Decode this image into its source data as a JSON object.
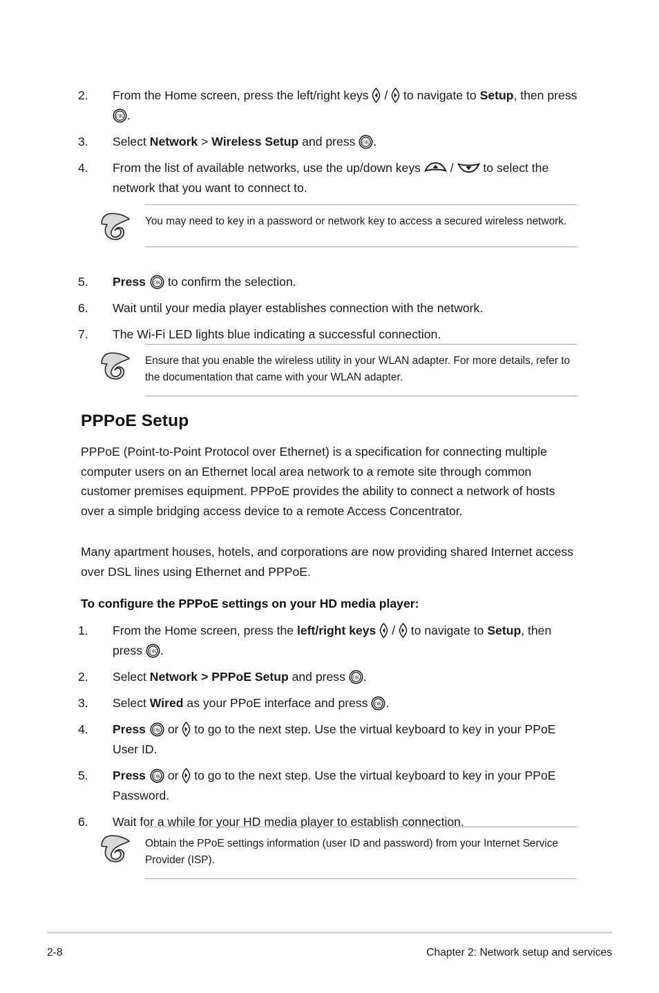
{
  "page": {
    "footer_page_number": "2-8",
    "footer_chapter": "Chapter 2:  Network setup and services"
  },
  "wireless_steps": [
    {
      "num": "2.",
      "parts": [
        {
          "t": "From the Home screen, press the left/right keys ",
          "s": "normal"
        },
        {
          "t": "left-key-icon",
          "s": "icon"
        },
        {
          "t": " / ",
          "s": "normal"
        },
        {
          "t": "right-key-icon",
          "s": "icon"
        },
        {
          "t": " to navigate to ",
          "s": "normal"
        },
        {
          "t": "Setup",
          "s": "bold"
        },
        {
          "t": ", then press ",
          "s": "normal"
        },
        {
          "t": "ok-key-icon",
          "s": "icon"
        },
        {
          "t": ".",
          "s": "normal"
        }
      ],
      "plain": "From the Home screen, press the left/right keys ◁ / ▷ to navigate to Setup, then press OK."
    },
    {
      "num": "3.",
      "plain": "Select Network > Wireless Setup and press OK."
    },
    {
      "num": "4.",
      "plain": "From the list of available networks, use the up/down keys ⌃ / ⌄ to select the network that you want to connect to."
    },
    {
      "num": "5.",
      "plain": "Press OK to confirm the selection."
    },
    {
      "num": "6.",
      "plain": "Wait until your media player establishes connection with the network."
    },
    {
      "num": "7.",
      "plain": "The Wi-Fi LED lights blue indicating a successful connection."
    }
  ],
  "step_text": {
    "s2_a": "From the Home screen, press the left/right keys ",
    "s2_b": " / ",
    "s2_c": " to navigate to ",
    "s2_setup": "Setup",
    "s2_d": ", then press ",
    "s2_e": ".",
    "s3_a": "Select ",
    "s3_network": "Network",
    "s3_b": " > ",
    "s3_wireless": "Wireless Setup",
    "s3_c": " and press ",
    "s3_d": ".",
    "s4_a": "From the list of available networks, use the up/down keys ",
    "s4_b": " / ",
    "s4_c": " to select the network that you want to connect to.",
    "s5_press": "Press",
    "s5_a": " to confirm the selection.",
    "s6": "Wait until your media player establishes connection with the network.",
    "s7": "The Wi-Fi LED lights blue indicating a successful connection."
  },
  "notes": [
    {
      "id": "note-wireless-password",
      "icon": "note-pencil-icon",
      "text": "You may need to key in a password or network key to access a secured wireless network."
    },
    {
      "id": "note-wlan-utility",
      "icon": "note-pencil-icon",
      "text": "Ensure that you enable the wireless utility in your WLAN adapter. For more details, refer to the documentation that came with your WLAN adapter."
    },
    {
      "id": "note-isp-settings",
      "icon": "note-pencil-icon",
      "text": "Obtain the PPoE settings information (user ID and password) from your Internet Service Provider (ISP)."
    }
  ],
  "pppoe": {
    "heading": "PPPoE Setup",
    "paragraph_1": "PPPoE (Point-to-Point Protocol over Ethernet) is a specification for connecting multiple computer users on an Ethernet local area network to a remote site through common customer premises equipment. PPPoE provides the ability to connect a network of hosts over a simple bridging access device to a remote Access Concentrator.",
    "paragraph_2": "Many apartment houses, hotels, and corporations are now providing shared Internet access over DSL lines using Ethernet and PPPoE.",
    "lead_in": "To configure the PPPoE settings on your HD media player:",
    "steps": {
      "p1_num": "1.",
      "p1_a": "From the Home screen, press the ",
      "p1_keys": "left/right keys",
      "p1_b": " ",
      "p1_c": " / ",
      "p1_d": " to navigate to ",
      "p1_setup": "Setup",
      "p1_e": ", then press ",
      "p1_f": ".",
      "p2_num": "2.",
      "p2_a": "Select ",
      "p2_bold": "Network > PPPoE Setup",
      "p2_b": " and press ",
      "p2_c": ".",
      "p3_num": "3.",
      "p3_a": "Select ",
      "p3_bold": "Wired",
      "p3_b": " as your PPoE interface and press ",
      "p3_c": ".",
      "p4_num": "4.",
      "p4_press": "Press",
      "p4_a": " or ",
      "p4_b": " to go to the next step. Use the virtual keyboard to key in your PPoE User ID.",
      "p5_num": "5.",
      "p5_press": "Press",
      "p5_a": " or ",
      "p5_b": " to go to the next step. Use the virtual keyboard to key in your PPoE Password.",
      "p6_num": "6.",
      "p6_a": "Wait for a while for your HD media player to establish connection."
    }
  },
  "icons": {
    "left_key": "left-key-icon",
    "right_key": "right-key-icon",
    "up_key": "up-key-icon",
    "down_key": "down-key-icon",
    "ok_key": "ok-key-icon",
    "note_pencil": "note-pencil-icon"
  },
  "colors": {
    "text": "#1a1a1a",
    "rule": "#a8a8a8",
    "footer_rule": "#d6d6d6",
    "note_icon_fill": "#d9d9d9"
  }
}
